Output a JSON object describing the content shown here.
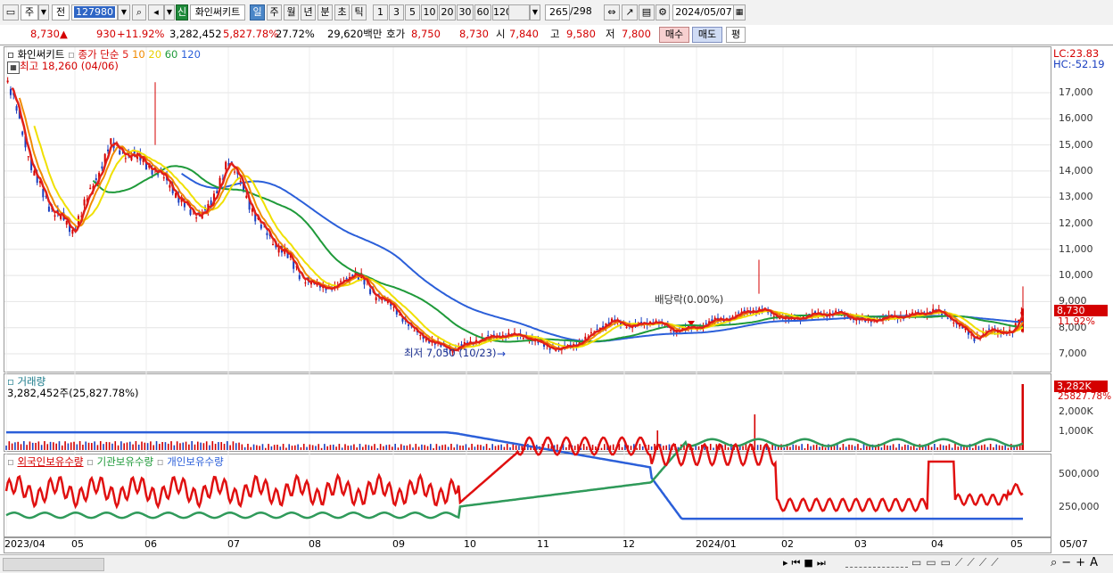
{
  "toolbar": {
    "market": "주",
    "prev": "전",
    "code": "127980",
    "new_badge": "신",
    "stock_name": "화인써키트",
    "periods": [
      "일",
      "주",
      "월",
      "년",
      "분",
      "초",
      "틱"
    ],
    "intervals": [
      "1",
      "3",
      "5",
      "10",
      "20",
      "30",
      "60",
      "120"
    ],
    "count": "265",
    "total": "/298",
    "date": "2024/05/07"
  },
  "quote": {
    "price": "8,730",
    "change": "930",
    "change_pct": "+11.92%",
    "volume": "3,282,452",
    "volume_ratio": "5,827.78%",
    "turnover": "27.72%",
    "amount": "29,620백만",
    "bid_label": "호가",
    "bid": "8,750",
    "ask": "8,730",
    "open_label": "시",
    "open": "7,840",
    "high_label": "고",
    "high": "9,580",
    "low_label": "저",
    "low": "7,800",
    "buy": "매수",
    "sell": "매도",
    "eval": "평"
  },
  "price_panel": {
    "legend_name": "화인써키트",
    "legend_ma": "종가 단순",
    "ma_periods": [
      "5",
      "10",
      "20",
      "60",
      "120"
    ],
    "high_note": "최고 18,260 (04/06)",
    "low_note": "최저 7,050 (10/23)",
    "dividend_note": "배당락(0.00%)",
    "lc": "LC:23.83",
    "hc": "HC:-52.19",
    "yticks": [
      "17,000",
      "16,000",
      "15,000",
      "14,000",
      "13,000",
      "12,000",
      "11,000",
      "10,000",
      "9,000",
      "8,000",
      "7,000"
    ],
    "current_price_tag": "8,730",
    "current_pct_tag": "11.92%"
  },
  "volume_panel": {
    "title": "거래량",
    "value": "3,282,452주(25,827.78%)",
    "yticks": [
      "2,000K",
      "1,000K"
    ],
    "tag": "3,282K",
    "tag_pct": "25827.78%"
  },
  "holdings_panel": {
    "series": [
      "외국인보유수량",
      "기관보유수량",
      "개인보유수량"
    ],
    "yticks": [
      "500,000",
      "250,000"
    ]
  },
  "xaxis": [
    "2023/04",
    "05",
    "06",
    "07",
    "08",
    "09",
    "10",
    "11",
    "12",
    "2024/01",
    "02",
    "03",
    "04",
    "05",
    "05/07"
  ],
  "colors": {
    "ma5": "#e0201a",
    "ma10": "#f08a00",
    "ma20": "#f0e000",
    "ma60": "#1f9a3a",
    "ma120": "#2b5fd9",
    "up": "#d40000",
    "down": "#1a3fc0"
  }
}
